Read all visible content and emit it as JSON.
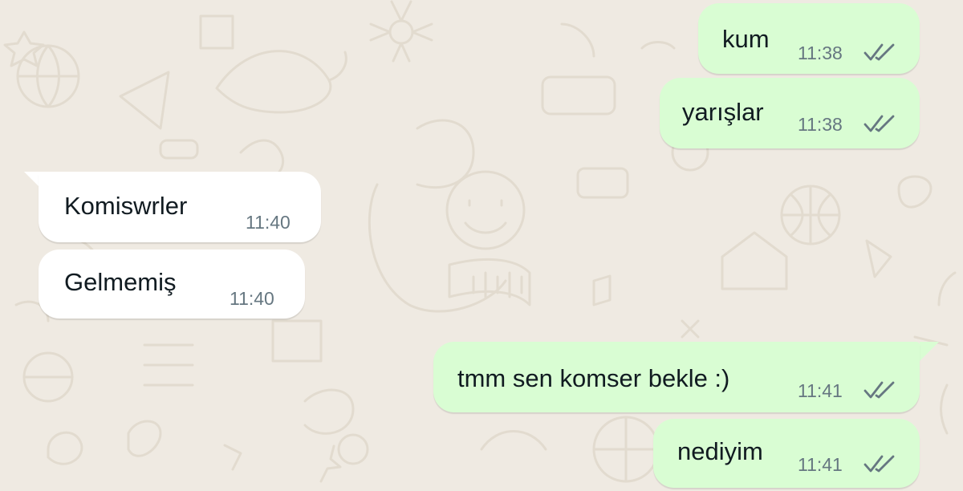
{
  "theme": {
    "wallpaper_color": "#efeae2",
    "doodle_color": "#e2dbcf",
    "outgoing_bubble_color": "#d9fdd3",
    "incoming_bubble_color": "#ffffff",
    "text_color": "#111b21",
    "time_color": "#667781",
    "read_receipt_color": "#667781"
  },
  "messages": [
    {
      "direction": "outgoing",
      "text": "kum",
      "time": "11:38",
      "status_icon": "double-check-icon"
    },
    {
      "direction": "outgoing",
      "text": "yarışlar",
      "time": "11:38",
      "status_icon": "double-check-icon"
    },
    {
      "direction": "incoming",
      "text": "Komiswrler",
      "time": "11:40"
    },
    {
      "direction": "incoming",
      "text": "Gelmemiş",
      "time": "11:40"
    },
    {
      "direction": "outgoing",
      "text": "tmm sen komser bekle :)",
      "time": "11:41",
      "status_icon": "double-check-icon"
    },
    {
      "direction": "outgoing",
      "text": "nediyim",
      "time": "11:41",
      "status_icon": "double-check-icon"
    }
  ]
}
